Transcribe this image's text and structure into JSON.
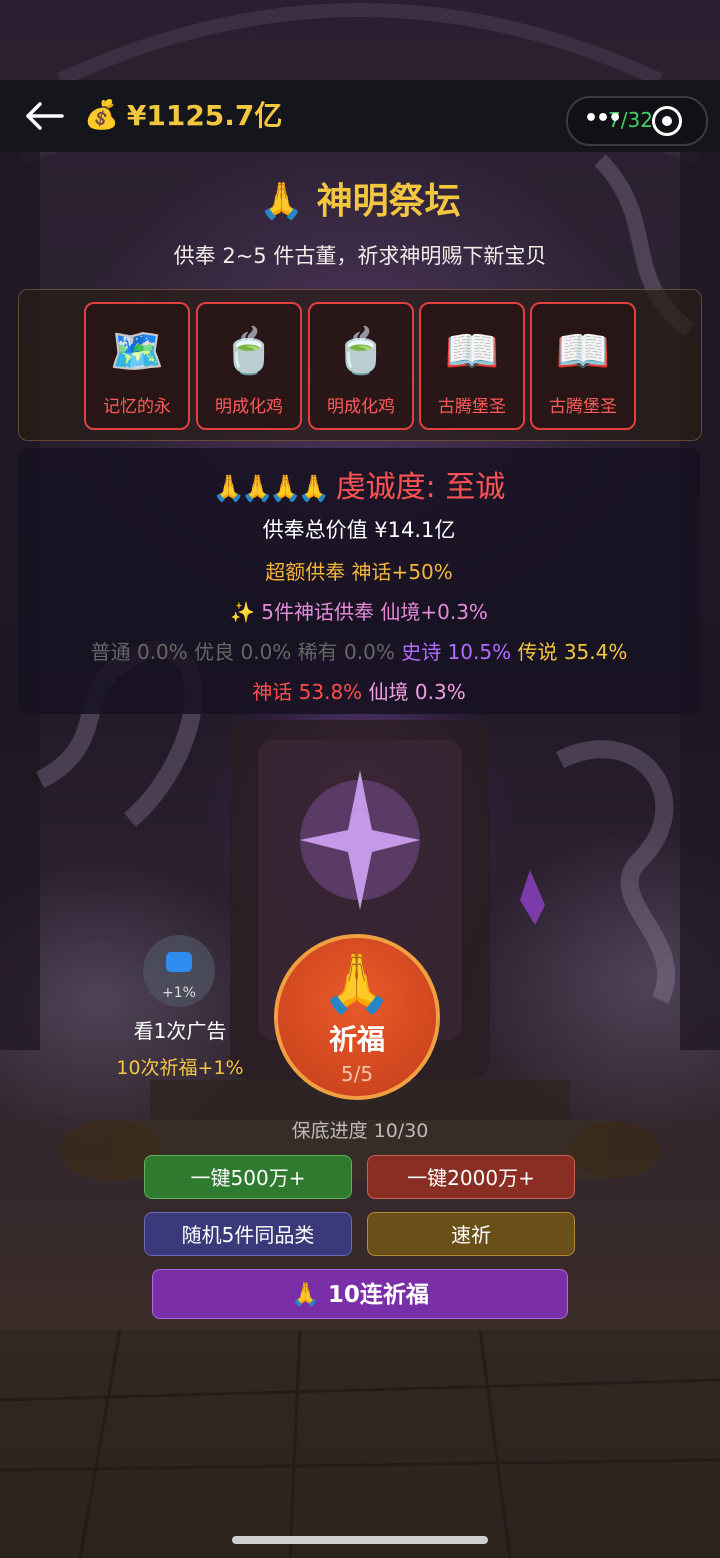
{
  "header": {
    "money_icon": "money-bag-icon",
    "money": "¥1125.7亿",
    "energy": "7/32"
  },
  "altar": {
    "title": "🙏 神明祭坛",
    "subtitle": "供奉 2~5 件古董，祈求神明赐下新宝贝"
  },
  "offerings": [
    {
      "icon": "🗺️",
      "name": "记忆的永"
    },
    {
      "icon": "🍵",
      "name": "明成化鸡"
    },
    {
      "icon": "🍵",
      "name": "明成化鸡"
    },
    {
      "icon": "📖",
      "name": "古腾堡圣"
    },
    {
      "icon": "📖",
      "name": "古腾堡圣"
    }
  ],
  "stats": {
    "hands": "🙏🙏🙏🙏",
    "piety": "虔诚度: 至诚",
    "total_value": "供奉总价值 ¥14.1亿",
    "overpay": "超额供奉 神话+50%",
    "bonus": "✨ 5件神话供奉 仙境+0.3%",
    "probabilities": {
      "common": "普通 0.0%",
      "good": "优良 0.0%",
      "rare": "稀有 0.0%",
      "epic": "史诗 10.5%",
      "legend": "传说 35.4%",
      "myth": "神话 53.8%",
      "fairy": "仙境 0.3%"
    }
  },
  "ad": {
    "plus": "+1%",
    "label": "看1次广告",
    "sub": "10次祈福+1%"
  },
  "pray": {
    "hands": "🙏",
    "label": "祈福",
    "count": "5/5"
  },
  "pity": "保底进度 10/30",
  "buttons": {
    "one_click_500": "一键500万+",
    "one_click_2000": "一键2000万+",
    "random5": "随机5件同品类",
    "fast": "速祈",
    "ten_pull": "🙏 10连祈福"
  },
  "colors": {
    "gold": "#f3c63f",
    "red": "#ff4d4d",
    "purple": "#b26cff",
    "pray_button": "#d9481f"
  }
}
